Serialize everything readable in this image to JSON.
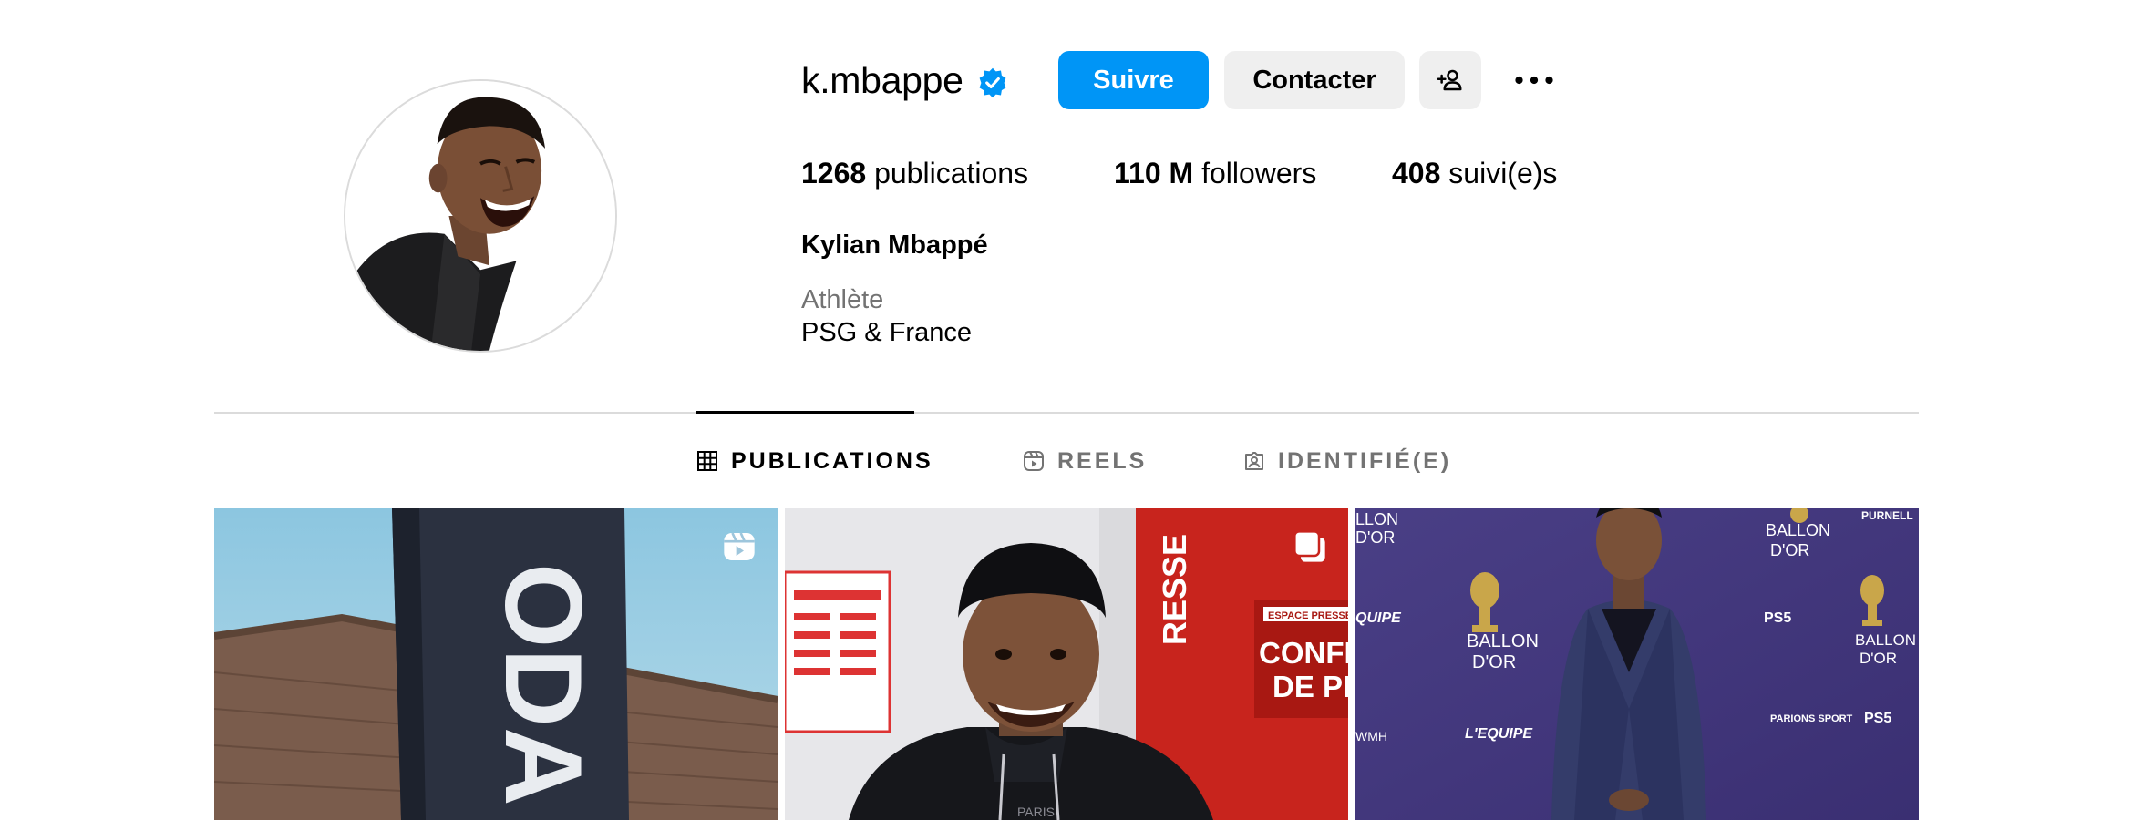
{
  "profile": {
    "username": "k.mbappe",
    "verified": true,
    "full_name": "Kylian Mbappé",
    "category": "Athlète",
    "bio": "PSG & France"
  },
  "actions": {
    "follow_label": "Suivre",
    "contact_label": "Contacter",
    "add_user_icon": "add-user-icon",
    "more_icon": "more-horizontal-icon"
  },
  "stats": {
    "posts_count": "1268",
    "posts_label": "publications",
    "followers_count": "110 M",
    "followers_label": "followers",
    "following_count": "408",
    "following_label": "suivi(e)s"
  },
  "tabs": [
    {
      "label": "PUBLICATIONS",
      "icon": "grid-icon",
      "active": true
    },
    {
      "label": "REELS",
      "icon": "reels-icon",
      "active": false
    },
    {
      "label": "IDENTIFIÉ(E)",
      "icon": "tagged-icon",
      "active": false
    }
  ],
  "posts": [
    {
      "type": "reel",
      "badge_icon": "reels-icon",
      "banner_text": "ODA"
    },
    {
      "type": "carousel",
      "badge_icon": "carousel-icon",
      "sign_line1": "CONFERE",
      "sign_line2": "DE PRES",
      "sign_top": "ESPACE PRESSE",
      "side_text": "RESSE",
      "hoodie_text": "PARIS"
    },
    {
      "type": "image",
      "badge_icon": null,
      "wall_brand": "BALLON",
      "wall_brand2": "D'OR",
      "sponsor_ps5": "PS5",
      "sponsor_lequipe": "L'EQUIPE",
      "sponsor_parions": "PARIONS SPORT",
      "sponsor_purnell": "PURNELL",
      "wall_left_top": "LLON",
      "wall_left_top2": "D'OR",
      "wall_left_mid": "QUIPE",
      "wall_left_low": "WMH"
    }
  ],
  "colors": {
    "accent": "#0095f6",
    "secondary_button": "#efefef",
    "muted_text": "#737373",
    "divider": "#dbdbdb",
    "verified_badge": "#0095f6"
  }
}
